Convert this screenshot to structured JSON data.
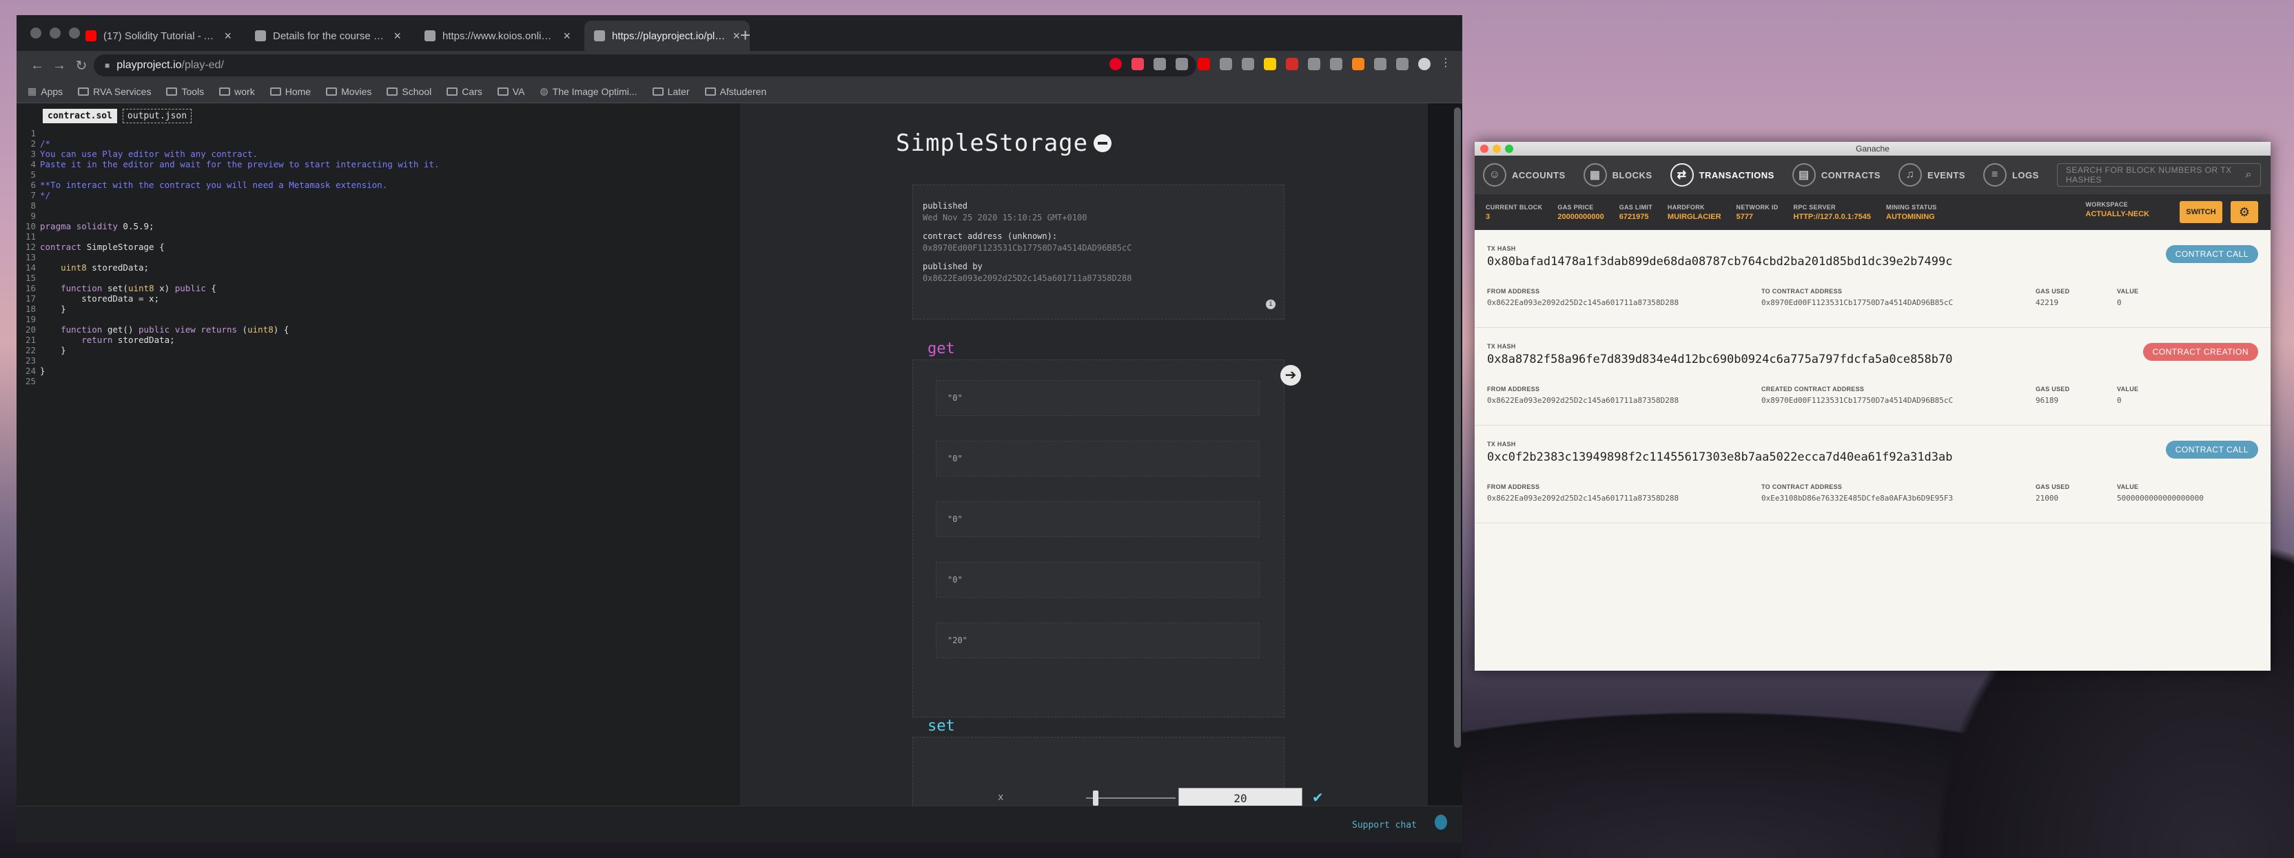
{
  "chrome": {
    "tabs": [
      {
        "title": "(17) Solidity Tutorial - A Full Co",
        "icon": "youtube-icon",
        "color": "#ff0000"
      },
      {
        "title": "Details for the course Program",
        "icon": "document-icon",
        "color": "#9aa0a6"
      },
      {
        "title": "https://www.koios.online/new",
        "icon": "globe-icon",
        "color": "#9aa0a6"
      },
      {
        "title": "https://playproject.io/play-ed/",
        "icon": "globe-icon",
        "color": "#9aa0a6"
      }
    ],
    "url_host": "playproject.io",
    "url_path": "/play-ed/",
    "bookmarks": [
      "Apps",
      "RVA Services",
      "Tools",
      "work",
      "Home",
      "Movies",
      "School",
      "Cars",
      "VA",
      "The Image Optimi...",
      "Later",
      "Afstuderen"
    ]
  },
  "editor": {
    "file_tabs": [
      "contract.sol",
      "output.json"
    ],
    "lines": [
      {
        "n": "1",
        "text": "",
        "kind": "plain"
      },
      {
        "n": "2",
        "text": "/*",
        "kind": "comment"
      },
      {
        "n": "3",
        "text": "You can use Play editor with any contract.",
        "kind": "comment"
      },
      {
        "n": "4",
        "text": "Paste it in the editor and wait for the preview to start interacting with it.",
        "kind": "comment"
      },
      {
        "n": "5",
        "text": "",
        "kind": "plain"
      },
      {
        "n": "6",
        "text": "**To interact with the contract you will need a Metamask extension.",
        "kind": "comment"
      },
      {
        "n": "7",
        "text": "*/",
        "kind": "comment"
      },
      {
        "n": "8",
        "text": "",
        "kind": "plain"
      },
      {
        "n": "9",
        "text": "",
        "kind": "plain"
      },
      {
        "n": "10",
        "text": "pragma solidity 0.5.9;",
        "kind": "plain"
      },
      {
        "n": "11",
        "text": "",
        "kind": "plain"
      },
      {
        "n": "12",
        "text": "contract SimpleStorage {",
        "kind": "plain"
      },
      {
        "n": "13",
        "text": "",
        "kind": "plain"
      },
      {
        "n": "14",
        "text": "    uint8 storedData;",
        "kind": "plain"
      },
      {
        "n": "15",
        "text": "",
        "kind": "plain"
      },
      {
        "n": "16",
        "text": "    function set(uint8 x) public {",
        "kind": "plain"
      },
      {
        "n": "17",
        "text": "        storedData = x;",
        "kind": "plain"
      },
      {
        "n": "18",
        "text": "    }",
        "kind": "plain"
      },
      {
        "n": "19",
        "text": "",
        "kind": "plain"
      },
      {
        "n": "20",
        "text": "    function get() public view returns (uint8) {",
        "kind": "plain"
      },
      {
        "n": "21",
        "text": "        return storedData;",
        "kind": "plain"
      },
      {
        "n": "22",
        "text": "    }",
        "kind": "plain"
      },
      {
        "n": "23",
        "text": "",
        "kind": "plain"
      },
      {
        "n": "24",
        "text": "}",
        "kind": "plain"
      },
      {
        "n": "25",
        "text": "",
        "kind": "plain"
      }
    ]
  },
  "preview": {
    "contract_name": "SimpleStorage",
    "published_label": "published",
    "published_date": "Wed Nov 25 2020 15:10:25 GMT+0100",
    "address_label": "contract address (unknown):",
    "address": "0x8970Ed00F1123531Cb17750D7a4514DAD96B85cC",
    "published_by_label": "published by",
    "published_by": "0x8622Ea093e2092d25D2c145a601711a87358D288",
    "get_label": "get",
    "get_outputs": [
      "\"0\"",
      "\"0\"",
      "\"0\"",
      "\"0\"",
      "\"20\""
    ],
    "set_label": "set",
    "set_param": "x",
    "set_value": "20",
    "support": "Support chat"
  },
  "ganache": {
    "title": "Ganache",
    "nav": [
      {
        "label": "ACCOUNTS",
        "icon": "accounts-icon",
        "glyph": "☺"
      },
      {
        "label": "BLOCKS",
        "icon": "blocks-icon",
        "glyph": "▦"
      },
      {
        "label": "TRANSACTIONS",
        "icon": "transactions-icon",
        "glyph": "⇄"
      },
      {
        "label": "CONTRACTS",
        "icon": "contracts-icon",
        "glyph": "▤"
      },
      {
        "label": "EVENTS",
        "icon": "events-icon",
        "glyph": "♫"
      },
      {
        "label": "LOGS",
        "icon": "logs-icon",
        "glyph": "≡"
      }
    ],
    "active_nav": "TRANSACTIONS",
    "search_placeholder": "SEARCH FOR BLOCK NUMBERS OR TX HASHES",
    "stats": [
      {
        "label": "CURRENT BLOCK",
        "value": "3"
      },
      {
        "label": "GAS PRICE",
        "value": "20000000000"
      },
      {
        "label": "GAS LIMIT",
        "value": "6721975"
      },
      {
        "label": "HARDFORK",
        "value": "MUIRGLACIER"
      },
      {
        "label": "NETWORK ID",
        "value": "5777"
      },
      {
        "label": "RPC SERVER",
        "value": "HTTP://127.0.0.1:7545"
      },
      {
        "label": "MINING STATUS",
        "value": "AUTOMINING"
      }
    ],
    "workspace_label": "WORKSPACE",
    "workspace_value": "ACTUALLY-NECK",
    "switch_label": "SWITCH",
    "tx_hash_label": "TX HASH",
    "from_label": "FROM ADDRESS",
    "gas_label": "GAS USED",
    "value_label": "VALUE",
    "transactions": [
      {
        "hash": "0x80bafad1478a1f3dab899de68da08787cb764cbd2ba201d85bd1dc39e2b7499c",
        "from": "0x8622Ea093e2092d25D2c145a601711a87358D288",
        "to_label": "TO CONTRACT ADDRESS",
        "to": "0x8970Ed00F1123531Cb17750D7a4514DAD96B85cC",
        "gas": "42219",
        "value": "0",
        "badge": "CONTRACT CALL",
        "badge_color": "#5a9fc0"
      },
      {
        "hash": "0x8a8782f58a96fe7d839d834e4d12bc690b0924c6a775a797fdcfa5a0ce858b70",
        "from": "0x8622Ea093e2092d25D2c145a601711a87358D288",
        "to_label": "CREATED CONTRACT ADDRESS",
        "to": "0x8970Ed00F1123531Cb17750D7a4514DAD96B85cC",
        "gas": "96189",
        "value": "0",
        "badge": "CONTRACT CREATION",
        "badge_color": "#e46a6a"
      },
      {
        "hash": "0xc0f2b2383c13949898f2c11455617303e8b7aa5022ecca7d40ea61f92a31d3ab",
        "from": "0x8622Ea093e2092d25D2c145a601711a87358D288",
        "to_label": "TO CONTRACT ADDRESS",
        "to": "0xEe3108bD86e76332E485DCfe8a0AFA3b6D9E95F3",
        "gas": "21000",
        "value": "5000000000000000000",
        "badge": "CONTRACT CALL",
        "badge_color": "#5a9fc0"
      }
    ]
  }
}
